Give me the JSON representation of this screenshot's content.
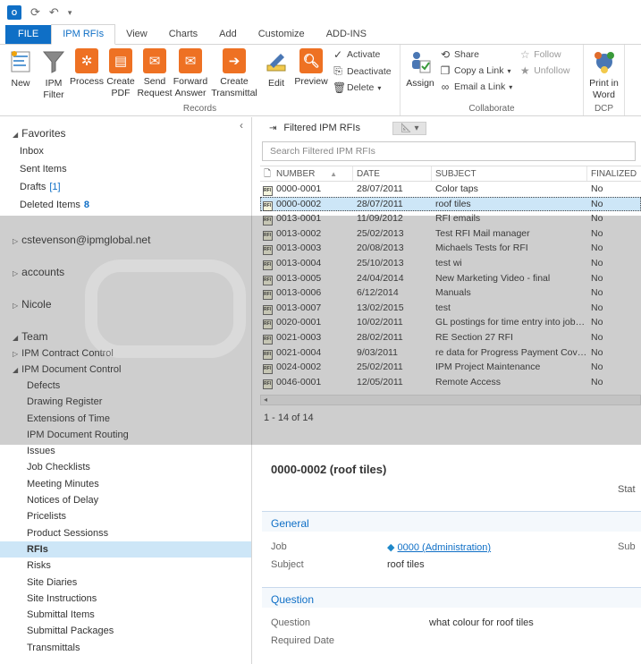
{
  "qat": {
    "app_icon": "O",
    "undo": "↶"
  },
  "tabs": [
    "FILE",
    "IPM RFIs",
    "View",
    "Charts",
    "Add",
    "Customize",
    "ADD-INS"
  ],
  "ribbon": {
    "records": {
      "label": "Records",
      "new": "New",
      "ipm_filter": "IPM Filter",
      "process": "Process",
      "create_pdf": "Create PDF",
      "send_request": "Send Request",
      "forward_answer": "Forward Answer",
      "create_transmittal": "Create Transmittal",
      "edit": "Edit",
      "preview": "Preview",
      "activate": "Activate",
      "deactivate": "Deactivate",
      "delete": "Delete"
    },
    "collaborate": {
      "label": "Collaborate",
      "assign": "Assign",
      "share": "Share",
      "copy_link": "Copy a Link",
      "email_link": "Email a Link",
      "follow": "Follow",
      "unfollow": "Unfollow"
    },
    "dcp": {
      "label": "DCP",
      "print_word": "Print in Word"
    }
  },
  "nav": {
    "favorites": "Favorites",
    "inbox": "Inbox",
    "sent": "Sent Items",
    "drafts": "Drafts",
    "drafts_count": "[1]",
    "deleted": "Deleted Items",
    "deleted_count": "8",
    "account1": "cstevenson@ipmglobal.net",
    "account2": "accounts",
    "account3": "Nicole",
    "team": "Team",
    "ipm_contract": "IPM Contract Control",
    "ipm_doc": "IPM Document Control",
    "doc_items": [
      "Defects",
      "Drawing Register",
      "Extensions of Time",
      "IPM Document Routing",
      "Issues",
      "Job Checklists",
      "Meeting Minutes",
      "Notices of Delay",
      "Pricelists",
      "Product Sessionss",
      "RFIs",
      "Risks",
      "Site Diaries",
      "Site Instructions",
      "Submittal Items",
      "Submittal Packages",
      "Transmittals"
    ]
  },
  "list": {
    "filter_title": "Filtered IPM RFIs",
    "search_placeholder": "Search Filtered IPM RFIs",
    "headers": {
      "number": "NUMBER",
      "date": "DATE",
      "subject": "SUBJECT",
      "finalized": "FINALIZED"
    },
    "rows": [
      {
        "number": "0000-0001",
        "date": "28/07/2011",
        "subject": "Color taps",
        "finalized": "No"
      },
      {
        "number": "0000-0002",
        "date": "28/07/2011",
        "subject": "roof tiles",
        "finalized": "No"
      },
      {
        "number": "0013-0001",
        "date": "11/09/2012",
        "subject": "RFI emails",
        "finalized": "No"
      },
      {
        "number": "0013-0002",
        "date": "25/02/2013",
        "subject": "Test RFI Mail manager",
        "finalized": "No"
      },
      {
        "number": "0013-0003",
        "date": "20/08/2013",
        "subject": "Michaels Tests for RFI",
        "finalized": "No"
      },
      {
        "number": "0013-0004",
        "date": "25/10/2013",
        "subject": "test wi",
        "finalized": "No"
      },
      {
        "number": "0013-0005",
        "date": "24/04/2014",
        "subject": "New Marketing Video - final",
        "finalized": "No"
      },
      {
        "number": "0013-0006",
        "date": "6/12/2014",
        "subject": "Manuals",
        "finalized": "No"
      },
      {
        "number": "0013-0007",
        "date": "13/02/2015",
        "subject": "test",
        "finalized": "No"
      },
      {
        "number": "0020-0001",
        "date": "10/02/2011",
        "subject": "GL postings for time entry into job c...",
        "finalized": "No"
      },
      {
        "number": "0021-0003",
        "date": "28/02/2011",
        "subject": "RE Section 27  RFI",
        "finalized": "No"
      },
      {
        "number": "0021-0004",
        "date": "9/03/2011",
        "subject": "re data for Progress Payment Cover l...",
        "finalized": "No"
      },
      {
        "number": "0024-0002",
        "date": "25/02/2011",
        "subject": "IPM Project Maintenance",
        "finalized": "No"
      },
      {
        "number": "0046-0001",
        "date": "12/05/2011",
        "subject": "Remote Access",
        "finalized": "No"
      }
    ],
    "count_text": "1 - 14 of 14"
  },
  "detail": {
    "title": "0000-0002 (roof tiles)",
    "stat": "Stat",
    "general": "General",
    "job_label": "Job",
    "job_value": "0000 (Administration)",
    "subject_label": "Subject",
    "subject_value": "roof tiles",
    "sub_label": "Sub",
    "question_section": "Question",
    "question_label": "Question",
    "question_value": "what colour for roof tiles",
    "required_date_label": "Required Date"
  }
}
